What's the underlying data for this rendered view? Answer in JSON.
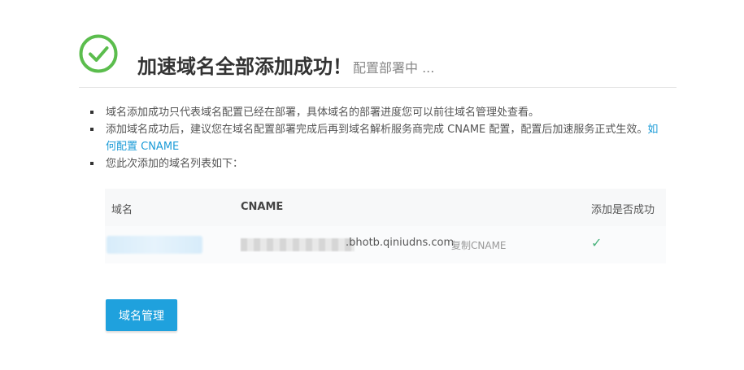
{
  "header": {
    "icon": "check-circle-icon",
    "title": "加速域名全部添加成功！",
    "status": "配置部署中 ..."
  },
  "notes": {
    "items": [
      {
        "text": "域名添加成功只代表域名配置已经在部署，具体域名的部署进度您可以前往域名管理处查看。"
      },
      {
        "text": "添加域名成功后，建议您在域名配置部署完成后再到域名解析服务商完成 CNAME 配置，配置后加速服务正式生效。",
        "link": "如何配置 CNAME"
      },
      {
        "text": "您此次添加的域名列表如下："
      }
    ]
  },
  "table": {
    "columns": [
      "域名",
      "CNAME",
      "添加是否成功"
    ],
    "rows": [
      {
        "domain": "",
        "cname_suffix": ".bhotb.qiniudns.com",
        "copy_label": "复制CNAME",
        "success_icon": "check-icon",
        "success": true
      }
    ]
  },
  "actions": {
    "manage_label": "域名管理"
  },
  "colors": {
    "accent": "#1fa1dd",
    "success": "#5bbd4d",
    "link": "#1a9bd7"
  }
}
